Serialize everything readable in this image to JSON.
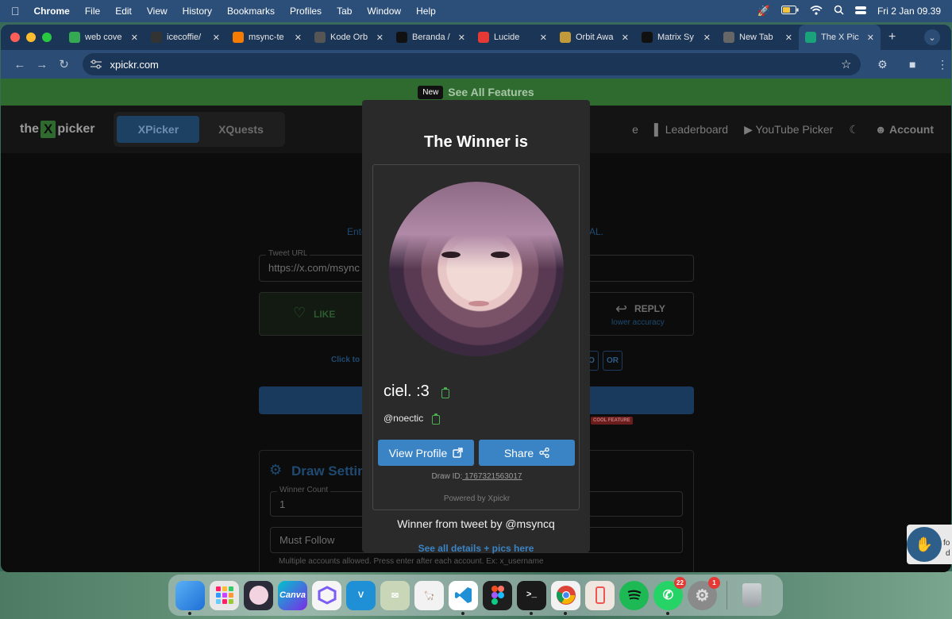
{
  "menubar": {
    "app": "Chrome",
    "menus": [
      "File",
      "Edit",
      "View",
      "History",
      "Bookmarks",
      "Profiles",
      "Tab",
      "Window",
      "Help"
    ],
    "datetime": "Fri 2 Jan  09.39"
  },
  "tabs": [
    {
      "title": "web cove",
      "color": "#34a853"
    },
    {
      "title": "icecoffie/",
      "color": "#333333"
    },
    {
      "title": "msync-te",
      "color": "#f57c00"
    },
    {
      "title": "Kode Orb",
      "color": "#555555"
    },
    {
      "title": "Beranda /",
      "color": "#111111"
    },
    {
      "title": "Lucide",
      "color": "#e53935"
    },
    {
      "title": "Orbit Awa",
      "color": "#c29a3a"
    },
    {
      "title": "Matrix Sy",
      "color": "#111111"
    },
    {
      "title": "New Tab",
      "color": "#666666"
    },
    {
      "title": "The X Pic",
      "color": "#1aa37a"
    }
  ],
  "address": "xpickr.com",
  "banner": {
    "badge": "New",
    "text": "See All Features"
  },
  "site": {
    "logo_pre": "the",
    "logo_x": "X",
    "logo_post": "picker",
    "modes": [
      "XPicker",
      "XQuests"
    ],
    "nav": {
      "partial": "e",
      "leaderboard": "Leaderboard",
      "youtube": "YouTube Picker",
      "account": "Account"
    }
  },
  "background_form": {
    "intro_left": "Ente",
    "intro_right": "AL.",
    "tweet_url_label": "Tweet URL",
    "tweet_url_value": "https://x.com/msync",
    "like": "LIKE",
    "reply": "REPLY",
    "reply_sub": "lower accuracy",
    "click_hint": "Click to",
    "chip_o": "O",
    "chip_or": "OR",
    "cool": "COOL FEATURE",
    "draw_settings": "Draw Settin",
    "winner_count_label": "Winner Count",
    "winner_count_value": "1",
    "must_follow": "Must Follow",
    "must_follow_hint": "Multiple accounts allowed. Press enter after each account. Ex: x_username"
  },
  "modal": {
    "title": "The Winner is",
    "name": "ciel. :3",
    "handle": "@noectic",
    "view_profile": "View Profile",
    "share": "Share",
    "draw_id_label": "Draw ID:",
    "draw_id": " 1767321563017",
    "powered": "Powered by Xpickr",
    "from_tweet": "Winner from tweet by @msyncq",
    "see_all": "See all details + pics here"
  },
  "chat_widget": {
    "fo": "fo",
    "d": "d"
  },
  "dock": {
    "whatsapp_badge": "22",
    "settings_badge": "1",
    "apps": [
      "finder",
      "launchpad",
      "cat-app",
      "Canva",
      "cube",
      "vscode-alt",
      "mail-scissors",
      "alpaca",
      "VS Code",
      "Figma",
      "Terminal",
      "Chrome",
      "phone-app",
      "Spotify",
      "WhatsApp",
      "Settings",
      "Trash"
    ]
  }
}
